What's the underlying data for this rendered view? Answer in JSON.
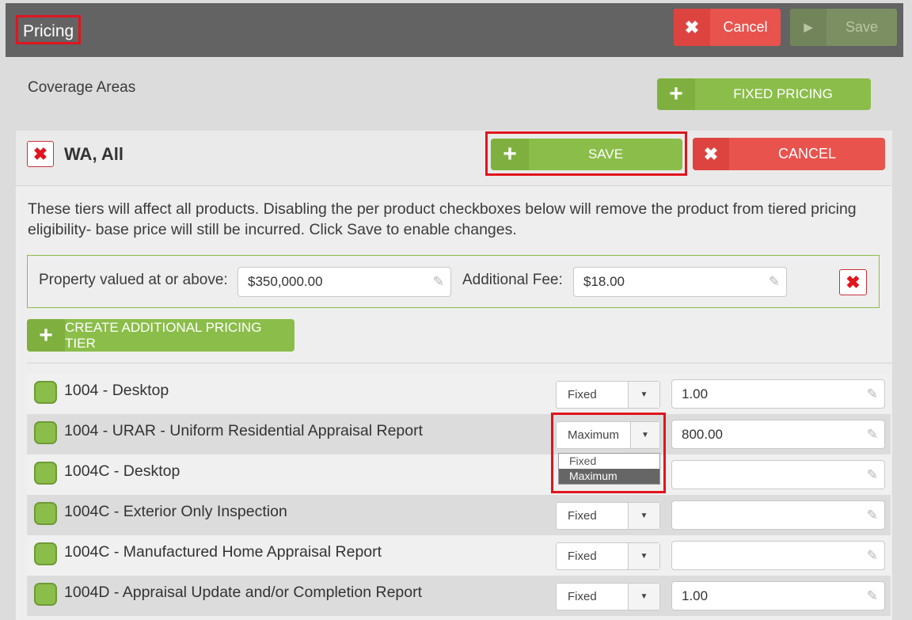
{
  "header": {
    "title": "Pricing",
    "cancel_label": "Cancel",
    "save_label": "Save"
  },
  "coverage": {
    "label": "Coverage Areas",
    "fixed_pricing_label": "FIXED PRICING"
  },
  "area": {
    "title": "WA, All",
    "save_label": "SAVE",
    "cancel_label": "CANCEL",
    "description": "These tiers will affect all products. Disabling the per product checkboxes below will remove the product from tiered pricing eligibility- base price will still be incurred. Click Save to enable changes."
  },
  "tier": {
    "property_label": "Property valued at or above:",
    "property_value": "$350,000.00",
    "fee_label": "Additional Fee:",
    "fee_value": "$18.00"
  },
  "create_tier_label": "CREATE ADDITIONAL PRICING TIER",
  "products": [
    {
      "name": "1004 - Desktop",
      "type": "Fixed",
      "value": "1.00"
    },
    {
      "name": "1004 - URAR - Uniform Residential Appraisal Report",
      "type": "Maximum",
      "value": "800.00"
    },
    {
      "name": "1004C - Desktop",
      "type": "",
      "value": ""
    },
    {
      "name": "1004C - Exterior Only Inspection",
      "type": "Fixed",
      "value": ""
    },
    {
      "name": "1004C - Manufactured Home Appraisal Report",
      "type": "Fixed",
      "value": ""
    },
    {
      "name": "1004D - Appraisal Update and/or Completion Report",
      "type": "Fixed",
      "value": "1.00"
    }
  ],
  "dropdown_options": [
    "Fixed",
    "Maximum"
  ],
  "colors": {
    "accent_green": "#8bbd4a",
    "cancel_red": "#e8534d",
    "header_gray": "#636363",
    "highlight_red": "#e0151e"
  }
}
